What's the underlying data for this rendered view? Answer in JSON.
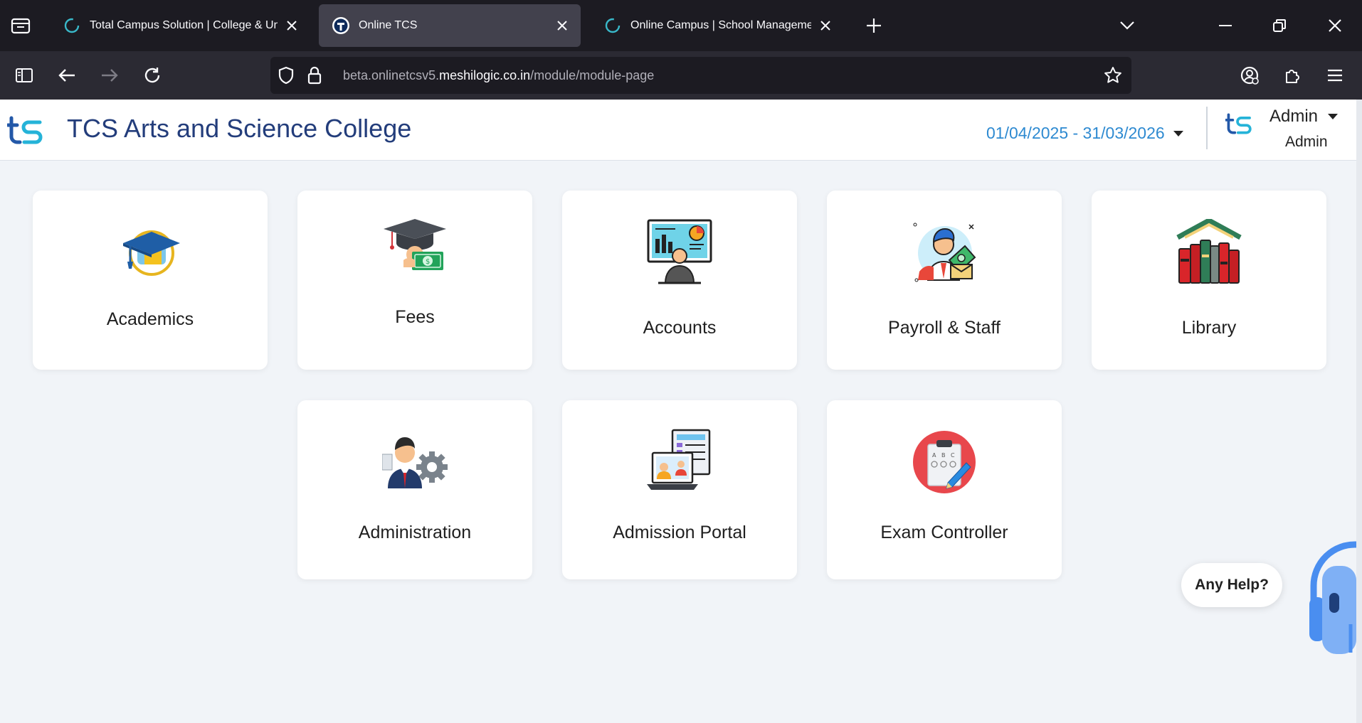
{
  "browser": {
    "tabs": [
      {
        "title": "Total Campus Solution | College & University Management",
        "active": false
      },
      {
        "title": "Online TCS",
        "active": true
      },
      {
        "title": "Online Campus | School Management ERP",
        "active": false
      }
    ],
    "url": {
      "prefix": "beta.onlinetcsv5.",
      "host": "meshilogic.co.in",
      "path": "/module/module-page"
    },
    "colors": {
      "tabbar": "#1c1b22",
      "navbar": "#2b2a33",
      "active_tab": "#42414d"
    }
  },
  "header": {
    "college_name": "TCS Arts and Science College",
    "date_range": "01/04/2025 - 31/03/2026",
    "user_name": "Admin",
    "user_role": "Admin",
    "colors": {
      "title": "#233d7b",
      "date": "#2e8ad1"
    }
  },
  "modules": [
    {
      "label": "Academics",
      "icon": "graduation-cap-icon"
    },
    {
      "label": "Fees",
      "icon": "fees-cap-money-icon"
    },
    {
      "label": "Accounts",
      "icon": "accounts-presentation-icon"
    },
    {
      "label": "Payroll & Staff",
      "icon": "payroll-staff-icon"
    },
    {
      "label": "Library",
      "icon": "library-books-icon"
    },
    {
      "label": "Administration",
      "icon": "administrator-gear-icon"
    },
    {
      "label": "Admission Portal",
      "icon": "admission-laptop-icon"
    },
    {
      "label": "Exam Controller",
      "icon": "exam-clipboard-icon"
    }
  ],
  "help": {
    "label": "Any Help?"
  }
}
